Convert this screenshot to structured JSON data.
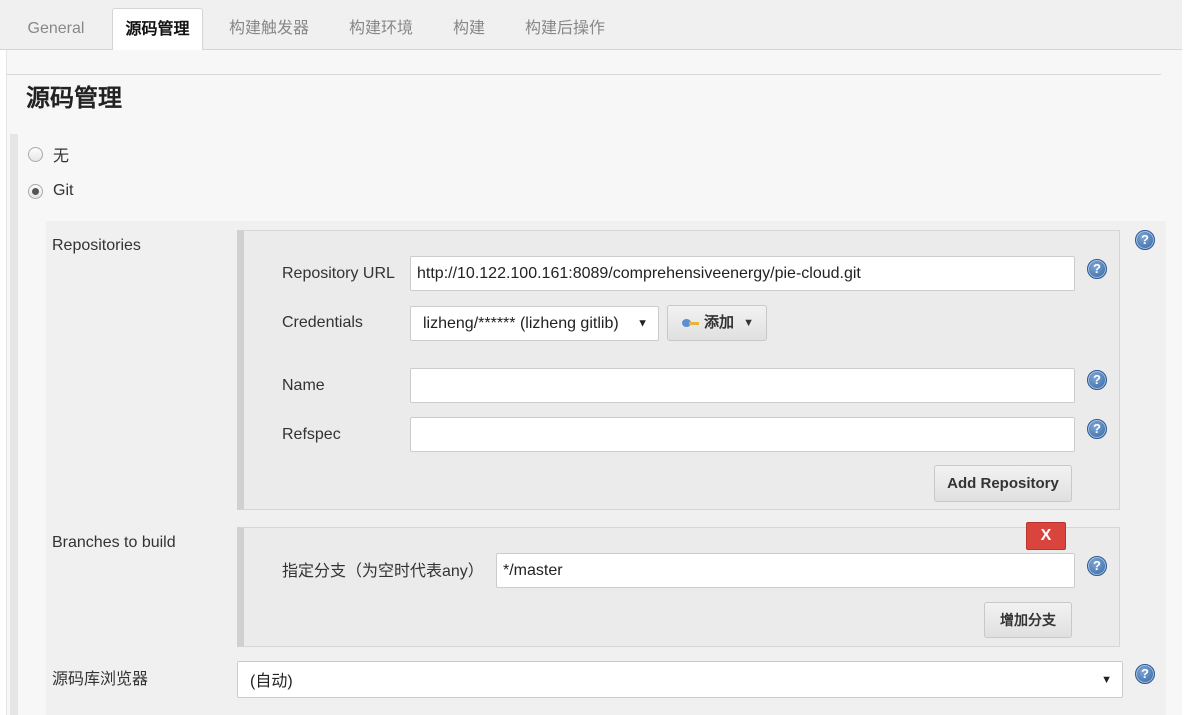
{
  "tabs": [
    "General",
    "源码管理",
    "构建触发器",
    "构建环境",
    "构建",
    "构建后操作"
  ],
  "section_title": "源码管理",
  "scm_options": {
    "none_label": "无",
    "git_label": "Git",
    "selected": "Git"
  },
  "repositories": {
    "label": "Repositories",
    "url_label": "Repository URL",
    "url_value": "http://10.122.100.161:8089/comprehensiveenergy/pie-cloud.git",
    "credentials_label": "Credentials",
    "credentials_value": "lizheng/****** (lizheng gitlib)",
    "add_button_label": "添加",
    "name_label": "Name",
    "name_value": "",
    "refspec_label": "Refspec",
    "refspec_value": "",
    "add_repository_label": "Add Repository"
  },
  "branches": {
    "label": "Branches to build",
    "delete_label": "X",
    "branch_spec_label": "指定分支（为空时代表any）",
    "branch_spec_value": "*/master",
    "add_branch_label": "增加分支"
  },
  "browser": {
    "label": "源码库浏览器",
    "value": "(自动)"
  },
  "help_icon_text": "?"
}
